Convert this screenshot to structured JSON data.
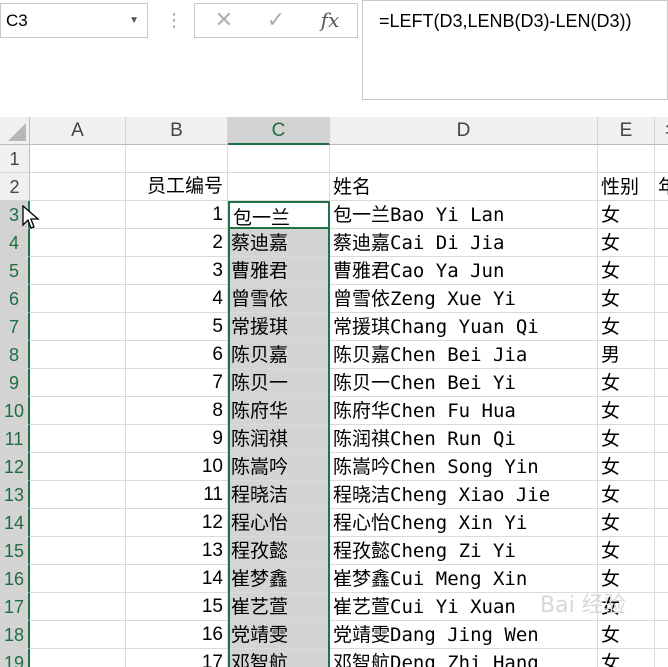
{
  "name_box": "C3",
  "formula": "=LEFT(D3,LENB(D3)-LEN(D3))",
  "toolbar": {
    "cancel_glyph": "✕",
    "confirm_glyph": "✓",
    "fx_glyph": "fx",
    "separator_glyph": "⋮"
  },
  "columns": [
    "A",
    "B",
    "C",
    "D",
    "E",
    "年"
  ],
  "header_row": {
    "B": "员工编号",
    "D": "姓名",
    "E": "性别",
    "F": "年"
  },
  "rows": [
    {
      "row": "1",
      "B": "",
      "C": "",
      "D": "",
      "E": ""
    },
    {
      "row": "2",
      "B": "员工编号",
      "C": "",
      "D": "姓名",
      "E": "性别"
    },
    {
      "row": "3",
      "B": "1",
      "C": "包一兰",
      "D": "包一兰Bao Yi Lan",
      "E": "女"
    },
    {
      "row": "4",
      "B": "2",
      "C": "蔡迪嘉",
      "D": "蔡迪嘉Cai Di Jia",
      "E": "女"
    },
    {
      "row": "5",
      "B": "3",
      "C": "曹雅君",
      "D": "曹雅君Cao Ya Jun",
      "E": "女"
    },
    {
      "row": "6",
      "B": "4",
      "C": "曾雪依",
      "D": "曾雪依Zeng Xue Yi",
      "E": "女"
    },
    {
      "row": "7",
      "B": "5",
      "C": "常援琪",
      "D": "常援琪Chang Yuan Qi",
      "E": "女"
    },
    {
      "row": "8",
      "B": "6",
      "C": "陈贝嘉",
      "D": "陈贝嘉Chen Bei Jia",
      "E": "男"
    },
    {
      "row": "9",
      "B": "7",
      "C": "陈贝一",
      "D": "陈贝一Chen Bei Yi",
      "E": "女"
    },
    {
      "row": "10",
      "B": "8",
      "C": "陈府华",
      "D": "陈府华Chen Fu Hua",
      "E": "女"
    },
    {
      "row": "11",
      "B": "9",
      "C": "陈润祺",
      "D": "陈润祺Chen Run Qi",
      "E": "女"
    },
    {
      "row": "12",
      "B": "10",
      "C": "陈嵩吟",
      "D": "陈嵩吟Chen Song Yin",
      "E": "女"
    },
    {
      "row": "13",
      "B": "11",
      "C": "程晓洁",
      "D": "程晓洁Cheng Xiao Jie",
      "E": "女"
    },
    {
      "row": "14",
      "B": "12",
      "C": "程心怡",
      "D": "程心怡Cheng Xin Yi",
      "E": "女"
    },
    {
      "row": "15",
      "B": "13",
      "C": "程孜懿",
      "D": "程孜懿Cheng Zi Yi",
      "E": "女"
    },
    {
      "row": "16",
      "B": "14",
      "C": "崔梦鑫",
      "D": "崔梦鑫Cui Meng Xin",
      "E": "女"
    },
    {
      "row": "17",
      "B": "15",
      "C": "崔艺萱",
      "D": "崔艺萱Cui Yi Xuan",
      "E": "女"
    },
    {
      "row": "18",
      "B": "16",
      "C": "党靖雯",
      "D": "党靖雯Dang Jing Wen",
      "E": "女"
    },
    {
      "row": "19",
      "B": "17",
      "C": "邓智航",
      "D": "邓智航Deng Zhi Hang",
      "E": "女"
    }
  ],
  "watermark": "Bai 经验",
  "colors": {
    "selection_green": "#217346",
    "selected_fill": "#d4d4d4",
    "header_fill": "#f0f0f0"
  }
}
